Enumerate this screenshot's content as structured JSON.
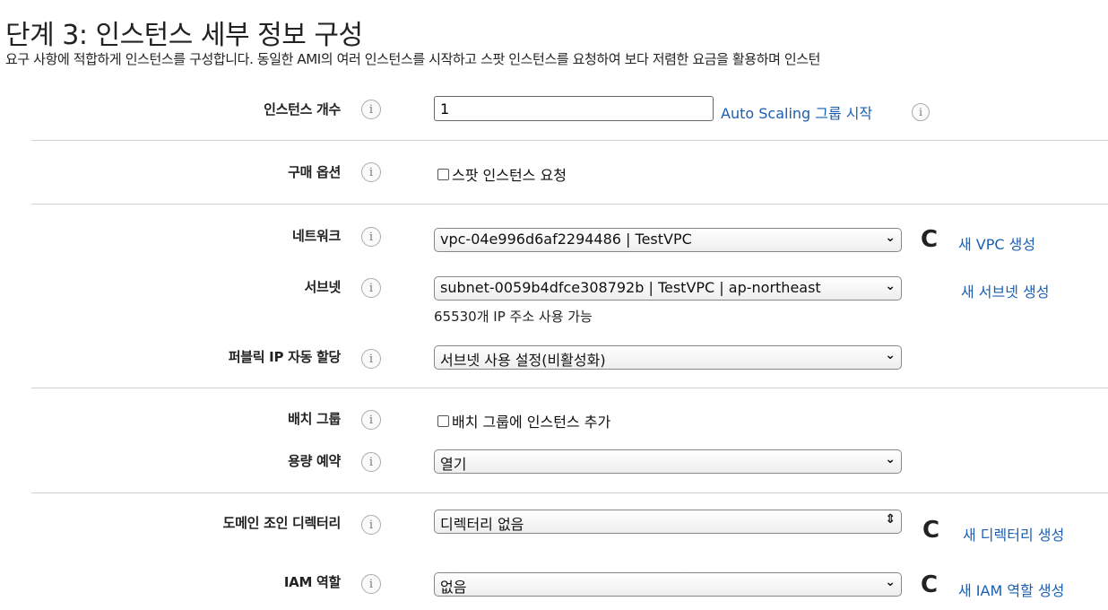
{
  "header": {
    "title": "단계 3: 인스턴스 세부 정보 구성",
    "description": "요구 사항에 적합하게 인스턴스를 구성합니다. 동일한 AMI의 여러 인스턴스를 시작하고 스팟 인스턴스를 요청하여 보다 저렴한 요금을 활용하며 인스턴"
  },
  "info_glyph": "i",
  "refresh_glyph": "C",
  "select_arrow": "⌄",
  "updown_arrow": "⇕",
  "instance_count": {
    "label": "인스턴스 개수",
    "value": "1",
    "autoscaling_link": "Auto Scaling 그룹 시작"
  },
  "purchase_option": {
    "label": "구매 옵션",
    "checkbox_label": "스팟 인스턴스 요청"
  },
  "network": {
    "label": "네트워크",
    "value": "vpc-04e996d6af2294486 | TestVPC",
    "create_link": "새 VPC 생성"
  },
  "subnet": {
    "label": "서브넷",
    "value": "subnet-0059b4dfce308792b | TestVPC | ap-northeast",
    "create_link": "새 서브넷 생성",
    "available_ips": "65530개 IP 주소 사용 가능"
  },
  "public_ip": {
    "label": "퍼블릭 IP 자동 할당",
    "value": "서브넷 사용 설정(비활성화)"
  },
  "placement_group": {
    "label": "배치 그룹",
    "checkbox_label": "배치 그룹에 인스턴스 추가"
  },
  "capacity_reservation": {
    "label": "용량 예약",
    "value": "열기"
  },
  "domain_directory": {
    "label": "도메인 조인 디렉터리",
    "value": "디렉터리 없음",
    "create_link": "새 디렉터리 생성"
  },
  "iam_role": {
    "label": "IAM 역할",
    "value": "없음",
    "create_link": "새 IAM 역할 생성"
  },
  "colors": {
    "link": "#1a5fb4",
    "divider": "#cfcfcf"
  }
}
